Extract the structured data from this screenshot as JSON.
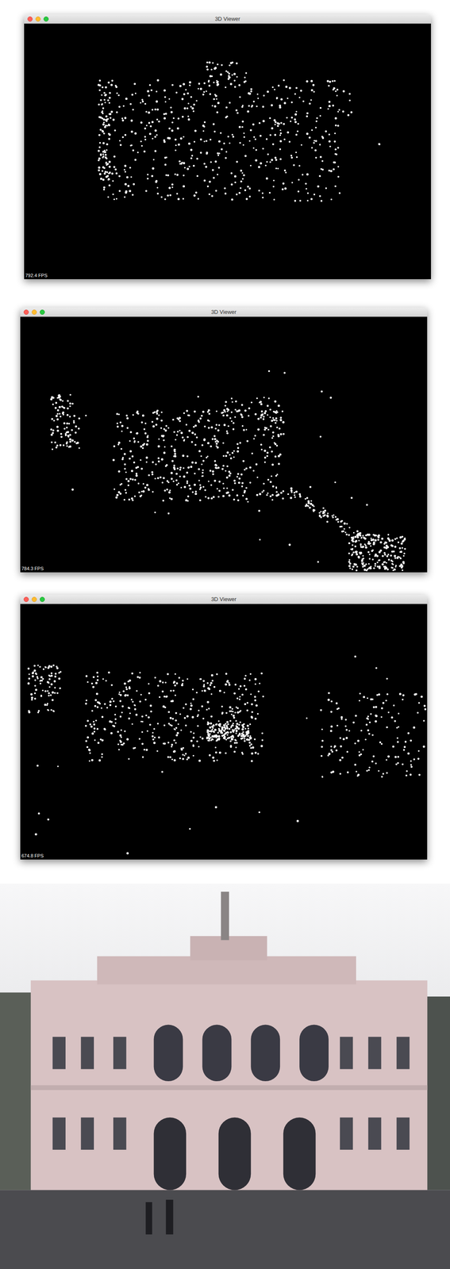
{
  "windows": [
    {
      "title": "3D Viewer",
      "fps": "792.4 FPS"
    },
    {
      "title": "3D Viewer",
      "fps": "784.3 FPS"
    },
    {
      "title": "3D Viewer",
      "fps": "674.8 FPS"
    }
  ]
}
